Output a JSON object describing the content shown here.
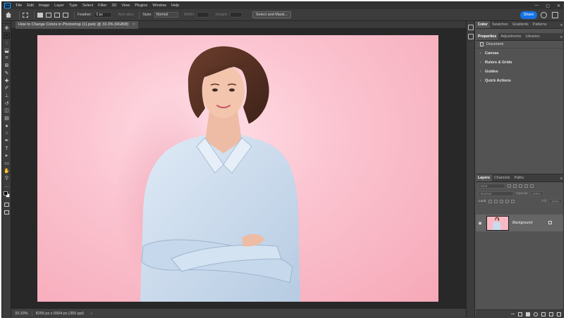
{
  "app": {
    "logo": "Ps",
    "menu": [
      "File",
      "Edit",
      "Image",
      "Layer",
      "Type",
      "Select",
      "Filter",
      "3D",
      "View",
      "Plugins",
      "Window",
      "Help"
    ],
    "window_controls": [
      "—",
      "▢",
      "✕"
    ]
  },
  "options_bar": {
    "feather_label": "Feather:",
    "feather_value": "0 px",
    "anti_alias_label": "Anti-alias",
    "style_label": "Style:",
    "style_value": "Normal",
    "width_label": "Width:",
    "height_label": "Height:",
    "select_mask_label": "Select and Mask...",
    "share_label": "Share"
  },
  "tools": [
    {
      "name": "move-tool",
      "glyph": "✥"
    },
    {
      "name": "marquee-tool",
      "glyph": "⬚",
      "active": true
    },
    {
      "name": "lasso-tool",
      "glyph": "◌"
    },
    {
      "name": "object-selection-tool",
      "glyph": "⬓"
    },
    {
      "name": "crop-tool",
      "glyph": "⌗"
    },
    {
      "name": "frame-tool",
      "glyph": "⊠"
    },
    {
      "name": "eyedropper-tool",
      "glyph": "✎"
    },
    {
      "name": "healing-brush-tool",
      "glyph": "✚"
    },
    {
      "name": "brush-tool",
      "glyph": "✐"
    },
    {
      "name": "clone-stamp-tool",
      "glyph": "⊥"
    },
    {
      "name": "history-brush-tool",
      "glyph": "↺"
    },
    {
      "name": "eraser-tool",
      "glyph": "◫"
    },
    {
      "name": "gradient-tool",
      "glyph": "▤"
    },
    {
      "name": "blur-tool",
      "glyph": "●"
    },
    {
      "name": "dodge-tool",
      "glyph": "○"
    },
    {
      "name": "pen-tool",
      "glyph": "✒"
    },
    {
      "name": "type-tool",
      "glyph": "T"
    },
    {
      "name": "path-selection-tool",
      "glyph": "▸"
    },
    {
      "name": "shape-tool",
      "glyph": "▭"
    },
    {
      "name": "hand-tool",
      "glyph": "✋"
    },
    {
      "name": "zoom-tool",
      "glyph": "⚲"
    },
    {
      "name": "more-tools",
      "glyph": "…"
    }
  ],
  "document": {
    "tab_title": "How to Change Colors in Photoshop (1).psdc @ 33.3% (RGB/8)",
    "close_glyph": "×"
  },
  "status": {
    "zoom": "33.33%",
    "dimensions": "8256 px x 5504 px (300 ppi)",
    "arrow": "›"
  },
  "panels": {
    "color_tabs": [
      "Color",
      "Swatches",
      "Gradients",
      "Patterns"
    ],
    "props_tabs": [
      "Properties",
      "Adjustments",
      "Libraries"
    ],
    "document_label": "Document",
    "sections": [
      "Canvas",
      "Rulers & Grids",
      "Guides",
      "Quick Actions"
    ],
    "layers_tabs": [
      "Layers",
      "Channels",
      "Paths"
    ],
    "kind_placeholder": "Kind",
    "blend_mode": "Normal",
    "opacity_label": "Opacity:",
    "opacity_value": "100%",
    "lock_label": "Lock:",
    "fill_label": "Fill:",
    "fill_value": "100%",
    "layer_name": "Background",
    "menu_glyph": "≡",
    "eye_glyph": "◉",
    "link_glyph": "⊶"
  },
  "colors": {
    "share": "#1473e6",
    "backdrop_pink": "#f6a8b8",
    "shirt_blue": "#c9dcee",
    "hair_brown": "#5a3326"
  }
}
